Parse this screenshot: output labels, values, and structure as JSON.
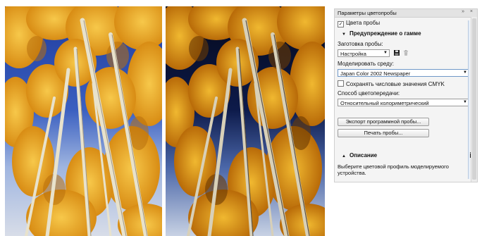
{
  "panel": {
    "title": "Параметры цветопробы",
    "window_buttons": "» ×",
    "color_proof_label": "Цвета пробы",
    "color_proof_checked": true,
    "gamut_warning_label": "Предупреждение о гамме",
    "preset_label": "Заготовка пробы:",
    "preset_value": "Настройка",
    "simulate_label": "Моделировать среду:",
    "simulate_value": "Japan Color 2002 Newspaper",
    "preserve_label": "Сохранять числовые значения CMYK",
    "preserve_checked": false,
    "rendering_label": "Способ цветопередачи:",
    "rendering_value": "Относительный колориметрический",
    "export_button": "Экспорт программной пробы...",
    "print_button": "Печать пробы...",
    "description_label": "Описание",
    "help_glyph": "?",
    "description_text": "Выберите цветовой профиль моделируемого устройства."
  },
  "colors": {
    "sky_left": "#2c4aa8",
    "sky_right": "#0a1330",
    "foliage": "#e9a520",
    "panel_bg": "#f4f4f4"
  }
}
